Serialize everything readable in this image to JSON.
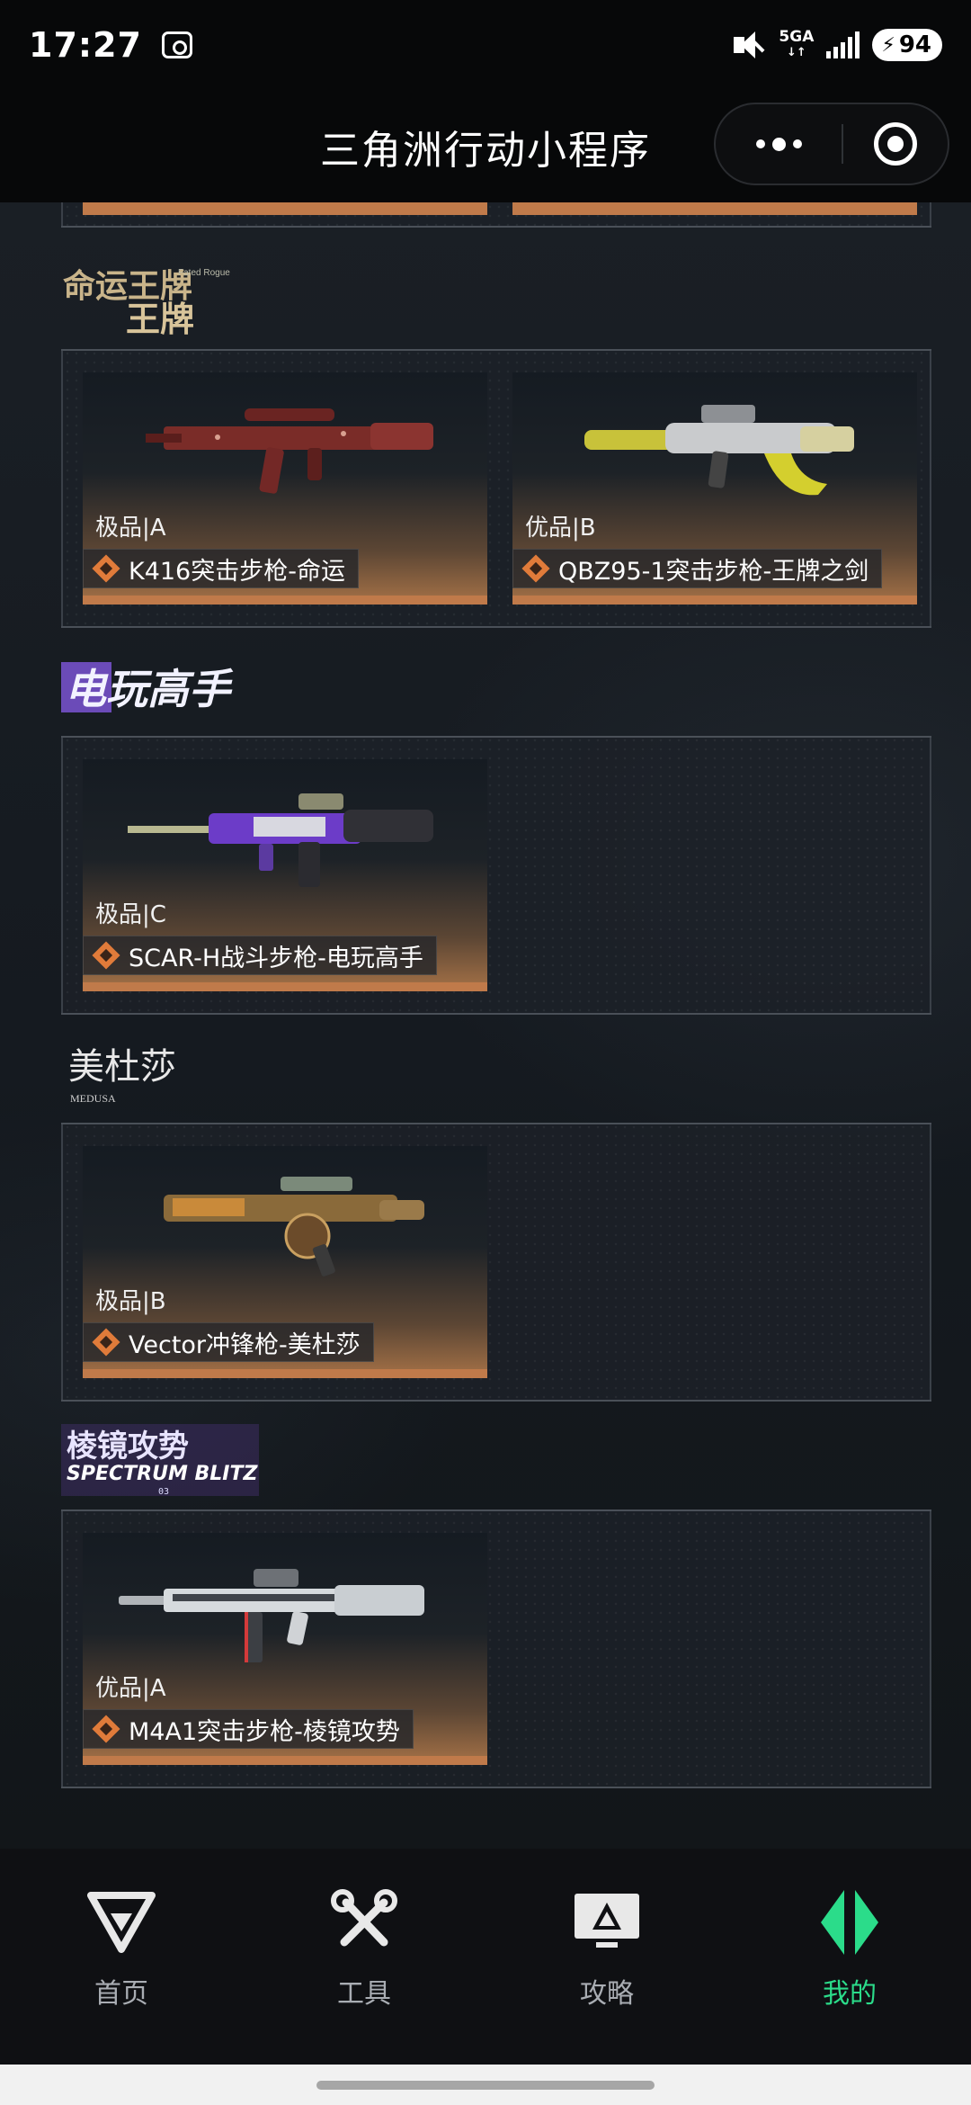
{
  "status_bar": {
    "time": "17:27",
    "network": "5GA",
    "battery": "94"
  },
  "header": {
    "title": "三角洲行动小程序"
  },
  "sections": [
    {
      "banner": "命运王牌",
      "banner_sub": "Fated Rogue",
      "cards": [
        {
          "grade": "极品|A",
          "name": "K416突击步枪-命运"
        },
        {
          "grade": "优品|B",
          "name": "QBZ95-1突击步枪-王牌之剑"
        }
      ]
    },
    {
      "banner": "电玩高手",
      "cards": [
        {
          "grade": "极品|C",
          "name": "SCAR-H战斗步枪-电玩高手"
        }
      ]
    },
    {
      "banner": "美杜莎",
      "banner_sub": "MEDUSA",
      "cards": [
        {
          "grade": "极品|B",
          "name": "Vector冲锋枪-美杜莎"
        }
      ]
    },
    {
      "banner": "棱镜攻势",
      "banner_sub": "SPECTRUM BLITZ",
      "banner_num": "03",
      "cards": [
        {
          "grade": "优品|A",
          "name": "M4A1突击步枪-棱镜攻势"
        }
      ]
    }
  ],
  "bottom_nav": {
    "items": [
      {
        "label": "首页",
        "icon": "home-logo-icon"
      },
      {
        "label": "工具",
        "icon": "tools-icon"
      },
      {
        "label": "攻略",
        "icon": "guide-monitor-icon"
      },
      {
        "label": "我的",
        "icon": "profile-logo-icon",
        "active": true
      }
    ],
    "active_color": "#2bdc8a"
  }
}
